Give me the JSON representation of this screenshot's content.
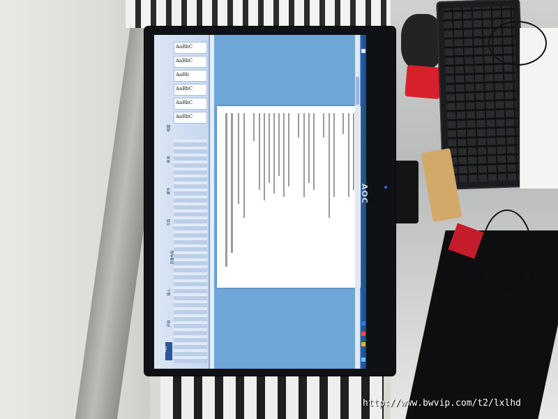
{
  "scene": {
    "monitor_brand": "AOC",
    "watermark": "http://www.bwvip.com/t2/lxlhd"
  },
  "app": {
    "file_tab": "File",
    "tabs": [
      "开始",
      "插入",
      "页面布局",
      "引用",
      "邮件",
      "审阅",
      "视图"
    ],
    "styles": [
      "AaBbC",
      "AaBbC",
      "AaBb",
      "AaBbC",
      "AaBbC",
      "AaBbC"
    ]
  },
  "colors": {
    "screen_blue": "#6fa6d8",
    "ribbon": "#c6d8ef",
    "taskbar": "#1e4a86",
    "led": "#2c6be8"
  }
}
